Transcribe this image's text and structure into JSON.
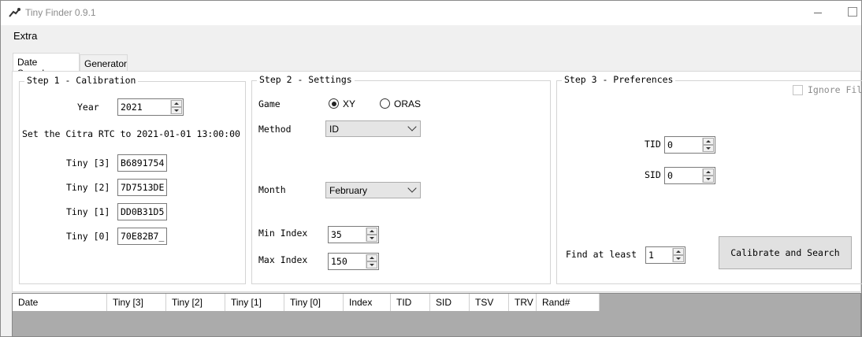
{
  "window": {
    "title": "Tiny Finder 0.9.1"
  },
  "menu": {
    "extra": "Extra"
  },
  "tabs": [
    {
      "label": "Date Searcher"
    },
    {
      "label": "Generator"
    }
  ],
  "step1": {
    "title": "Step 1 - Calibration",
    "year_label": "Year",
    "year_value": "2021",
    "instruction": "Set the Citra RTC to 2021-01-01 13:00:00",
    "tiny": [
      {
        "label": "Tiny [3]",
        "value": "B6891754"
      },
      {
        "label": "Tiny [2]",
        "value": "7D7513DE"
      },
      {
        "label": "Tiny [1]",
        "value": "DD0B31D5"
      },
      {
        "label": "Tiny [0]",
        "value": "70E82B7_"
      }
    ]
  },
  "step2": {
    "title": "Step 2 - Settings",
    "game_label": "Game",
    "game_options": [
      {
        "label": "XY",
        "selected": true
      },
      {
        "label": "ORAS",
        "selected": false
      }
    ],
    "method_label": "Method",
    "method_value": "ID",
    "month_label": "Month",
    "month_value": "February",
    "min_index_label": "Min Index",
    "min_index_value": "35",
    "max_index_label": "Max Index",
    "max_index_value": "150"
  },
  "step3": {
    "title": "Step 3 - Preferences",
    "ignore_filter_label": "Ignore Fil",
    "tid_label": "TID",
    "tid_value": "0",
    "sid_label": "SID",
    "sid_value": "0",
    "find_at_least_label": "Find at least",
    "find_at_least_value": "1",
    "calibrate_button": "Calibrate and Search"
  },
  "results_table": {
    "columns": [
      "Date",
      "Tiny [3]",
      "Tiny [2]",
      "Tiny [1]",
      "Tiny [0]",
      "Index",
      "TID",
      "SID",
      "TSV",
      "TRV",
      "Rand#"
    ]
  }
}
